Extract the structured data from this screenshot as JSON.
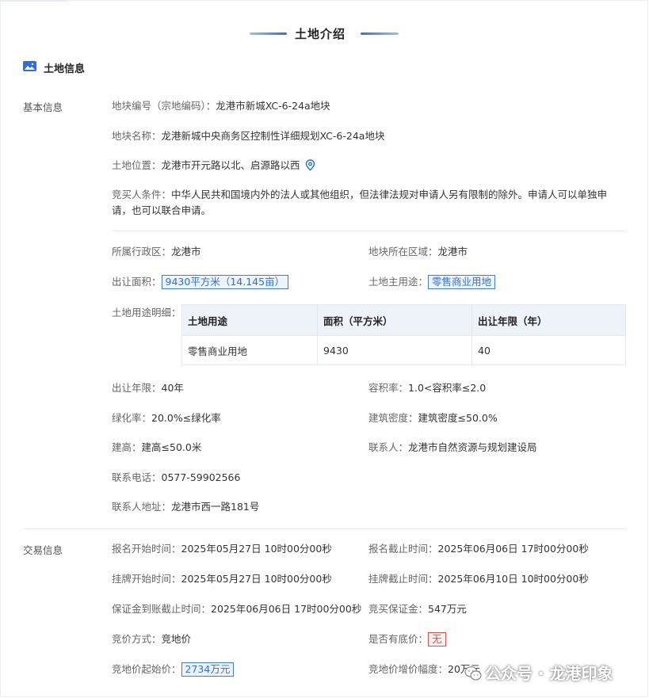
{
  "header": {
    "title": "土地介绍"
  },
  "section": {
    "title": "土地信息"
  },
  "basic": {
    "group_label": "基本信息",
    "parcel_no": {
      "label": "地块编号（宗地编码）：",
      "value": "龙港市新城XC-6-24a地块"
    },
    "parcel_name": {
      "label": "地块名称：",
      "value": "龙港新城中央商务区控制性详细规划XC-6-24a地块"
    },
    "location": {
      "label": "土地位置：",
      "value": "龙港市开元路以北、启源路以西"
    },
    "bidder": {
      "label": "竞买人条件：",
      "value": "中华人民共和国境内外的法人或其他组织，但法律法规对申请人另有限制的除外。申请人可以单独申请，也可以联合申请。"
    },
    "district": {
      "label": "所属行政区：",
      "value": "龙港市"
    },
    "region": {
      "label": "地块所在区域：",
      "value": "龙港市"
    },
    "area": {
      "label": "出让面积：",
      "value": "9430平方米（14.145亩）"
    },
    "main_use": {
      "label": "土地主用途：",
      "value": "零售商业用地"
    },
    "usage_detail_label": "土地用途明细：",
    "usage_table": {
      "headers": [
        "土地用途",
        "面积（平方米）",
        "出让年限（年）"
      ],
      "rows": [
        [
          "零售商业用地",
          "9430",
          "40"
        ]
      ]
    },
    "term": {
      "label": "出让年限：",
      "value": "40年"
    },
    "far": {
      "label": "容积率：",
      "value": "1.0<容积率≤2.0"
    },
    "green": {
      "label": "绿化率：",
      "value": "20.0%≤绿化率"
    },
    "density": {
      "label": "建筑密度：",
      "value": "建筑密度≤50.0%"
    },
    "height": {
      "label": "建高：",
      "value": "建高≤50.0米"
    },
    "contact": {
      "label": "联系人：",
      "value": "龙港市自然资源与规划建设局"
    },
    "phone": {
      "label": "联系电话：",
      "value": "0577-59902566"
    },
    "address": {
      "label": "联系人地址：",
      "value": "龙港市西一路181号"
    }
  },
  "trade": {
    "group_label": "交易信息",
    "reg_start": {
      "label": "报名开始时间：",
      "value": "2025年05月27日 10时00分00秒"
    },
    "reg_end": {
      "label": "报名截止时间：",
      "value": "2025年06月06日 17时00分00秒"
    },
    "list_start": {
      "label": "挂牌开始时间：",
      "value": "2025年05月27日 10时00分00秒"
    },
    "list_end": {
      "label": "挂牌截止时间：",
      "value": "2025年06月10日 10时00分00秒"
    },
    "deposit_deadline": {
      "label": "保证金到账截止时间：",
      "value": "2025年06月06日 17时00分00秒"
    },
    "deposit": {
      "label": "竞买保证金：",
      "value": "547万元"
    },
    "bid_method": {
      "label": "竞价方式：",
      "value": "竞地价"
    },
    "reserve": {
      "label": "是否有底价：",
      "value": "无"
    },
    "start_price": {
      "label": "竞地价起始价：",
      "value": "2734万元"
    },
    "increment": {
      "label": "竞地价增价幅度：",
      "value": "20万元"
    }
  },
  "watermark": {
    "text": "公众号 · 龙港印象"
  },
  "colors": {
    "accent": "#2f6fdc",
    "alert": "#e54d42"
  }
}
